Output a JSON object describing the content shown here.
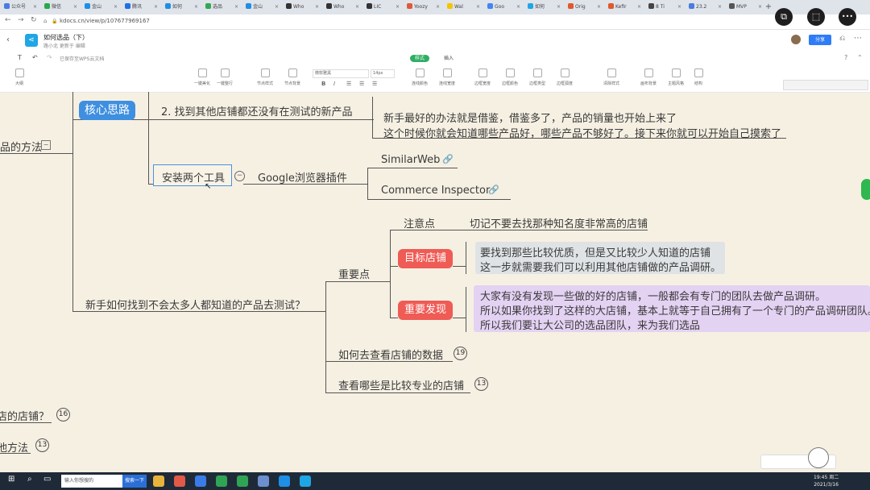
{
  "browser": {
    "tabs": [
      {
        "label": "公众号",
        "color": "#4a7be0"
      },
      {
        "label": "微信",
        "color": "#2aa84a"
      },
      {
        "label": "金山",
        "color": "#1f8ee5"
      },
      {
        "label": "腾讯",
        "color": "#1f6fe5"
      },
      {
        "label": "如何",
        "color": "#1f8ee5"
      },
      {
        "label": "选品",
        "color": "#34a853"
      },
      {
        "label": "金山",
        "color": "#1f8ee5"
      },
      {
        "label": "Who",
        "color": "#333333"
      },
      {
        "label": "Who",
        "color": "#333333"
      },
      {
        "label": "LIC",
        "color": "#333333"
      },
      {
        "label": "Yoozy",
        "color": "#e05a3a"
      },
      {
        "label": "Wal",
        "color": "#f5c400"
      },
      {
        "label": "Goo",
        "color": "#4285f4"
      },
      {
        "label": "如何",
        "color": "#1fa6e5"
      },
      {
        "label": "Orig",
        "color": "#e0582b"
      },
      {
        "label": "Kefir",
        "color": "#e0582b"
      },
      {
        "label": "8 Ti",
        "color": "#444444"
      },
      {
        "label": "23.2",
        "color": "#4a7be0"
      },
      {
        "label": "MVP",
        "color": "#555555"
      }
    ],
    "new_tab": "+",
    "url": "kdocs.cn/view/p/107677969167"
  },
  "doc": {
    "logo": "<",
    "title": "如何选品（下）",
    "subtitle": "路小北 更新于 编辑",
    "share": "分享",
    "saved_note": "已保存至WPS云文档"
  },
  "toolbar": {
    "tabs": [
      "样式",
      "插入"
    ],
    "tools": [
      "大纲",
      "一键美化",
      "一键整行",
      "节点样式",
      "节点背景",
      "连线颜色",
      "连线宽度",
      "边框宽度",
      "边框颜色",
      "边框类型",
      "边框弧度",
      "清除样式",
      "画布背景",
      "主题风格",
      "结构"
    ],
    "font": "微软雅黑",
    "size": "14px"
  },
  "overlay": {
    "icon1": "⧉",
    "icon2": "⬚",
    "icon3": "•••"
  },
  "mindmap": {
    "left_node_top": "品的方法",
    "core": "核心思路",
    "step2": "2. 找到其他店铺都还没有在测试的新产品",
    "step2_desc1": "新手最好的办法就是借鉴，借鉴多了，产品的销量也开始上来了",
    "step2_desc2": "这个时候你就会知道哪些产品好，哪些产品不够好了。接下来你就可以开始自己摸索了",
    "install_tools": "安装两个工具",
    "install_collapse": "−",
    "chrome_plugin": "Google浏览器插件",
    "similarweb": "SimilarWeb",
    "commerce": "Commerce Inspector",
    "newbie_q": "新手如何找到不会太多人都知道的产品去测试？",
    "key_points": "重要点",
    "note": "注意点",
    "note_desc": "切记不要去找那种知名度非常高的店铺",
    "target_shop": "目标店铺",
    "target_desc1": "要找到那些比较优质，但是又比较少人知道的店铺",
    "target_desc2": "这一步就需要我们可以利用其他店铺做的产品调研。",
    "key_find": "重要发现",
    "find_desc1": "大家有没有发现一些做的好的店铺，一般都会有专门的团队去做产品调研。",
    "find_desc2": "所以如果你找到了这样的大店铺，基本上就等于自己拥有了一个专门的产品调研团队。",
    "find_desc3": "所以我们要让大公司的选品团队，来为我们选品",
    "check_data": "如何去查看店铺的数据",
    "check_data_count": "19",
    "pro_shops": "查看哪些是比较专业的店铺",
    "pro_shops_count": "13",
    "left_node_2": "店的店铺？",
    "left_node_2_count": "16",
    "left_node_3": "他方法",
    "left_node_3_count": "13"
  },
  "taskbar": {
    "search_placeholder": "输入你想搜的",
    "search_button": "搜索一下",
    "time": "19:45 周二",
    "date": "2021/3/16"
  }
}
